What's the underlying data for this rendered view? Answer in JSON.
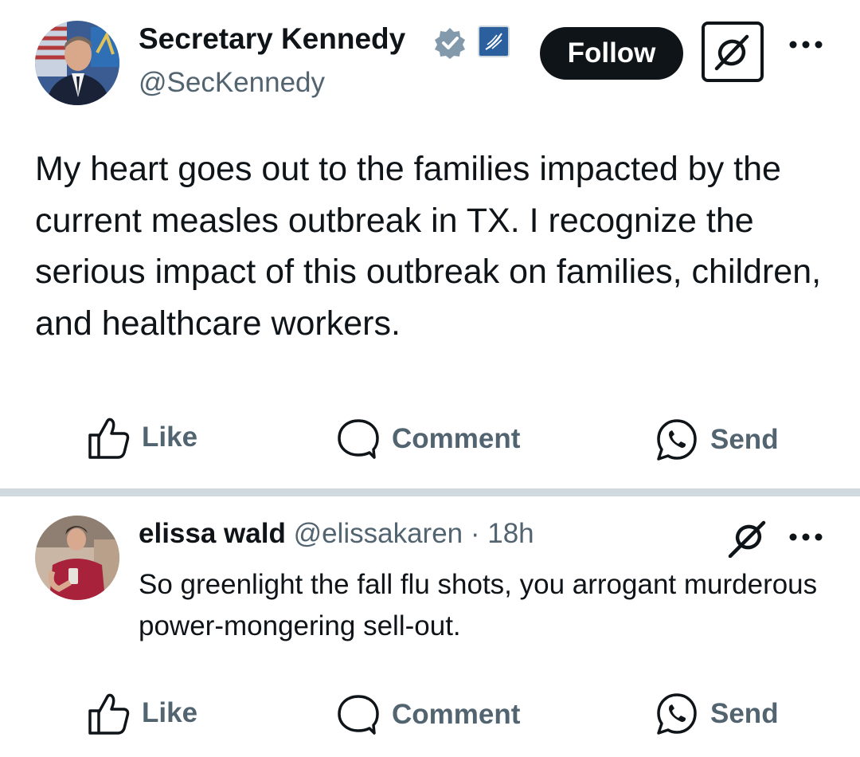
{
  "post": {
    "author_name": "Secretary Kennedy",
    "handle": "@SecKennedy",
    "follow_label": "Follow",
    "text": "My heart goes out to the families impacted by the current measles outbreak in TX. I recognize the serious impact of this outbreak on families, children, and healthcare workers.",
    "actions": {
      "like": "Like",
      "comment": "Comment",
      "send": "Send"
    },
    "icons": {
      "verified": "verified-badge-icon",
      "affiliate": "hhs-affiliate-icon",
      "grok": "grok-icon",
      "more": "more-icon"
    }
  },
  "reply": {
    "author_name": "elissa wald",
    "handle": "@elissakaren",
    "separator": " · ",
    "time": "18h",
    "text": "So greenlight the fall flu shots, you arrogant murderous power-mongering sell-out.",
    "actions": {
      "like": "Like",
      "comment": "Comment",
      "send": "Send"
    }
  },
  "colors": {
    "text": "#0f1419",
    "muted": "#536471",
    "verified": "#829aab",
    "affiliate_bg": "#2b5f9e",
    "divider": "#cfd9de"
  }
}
